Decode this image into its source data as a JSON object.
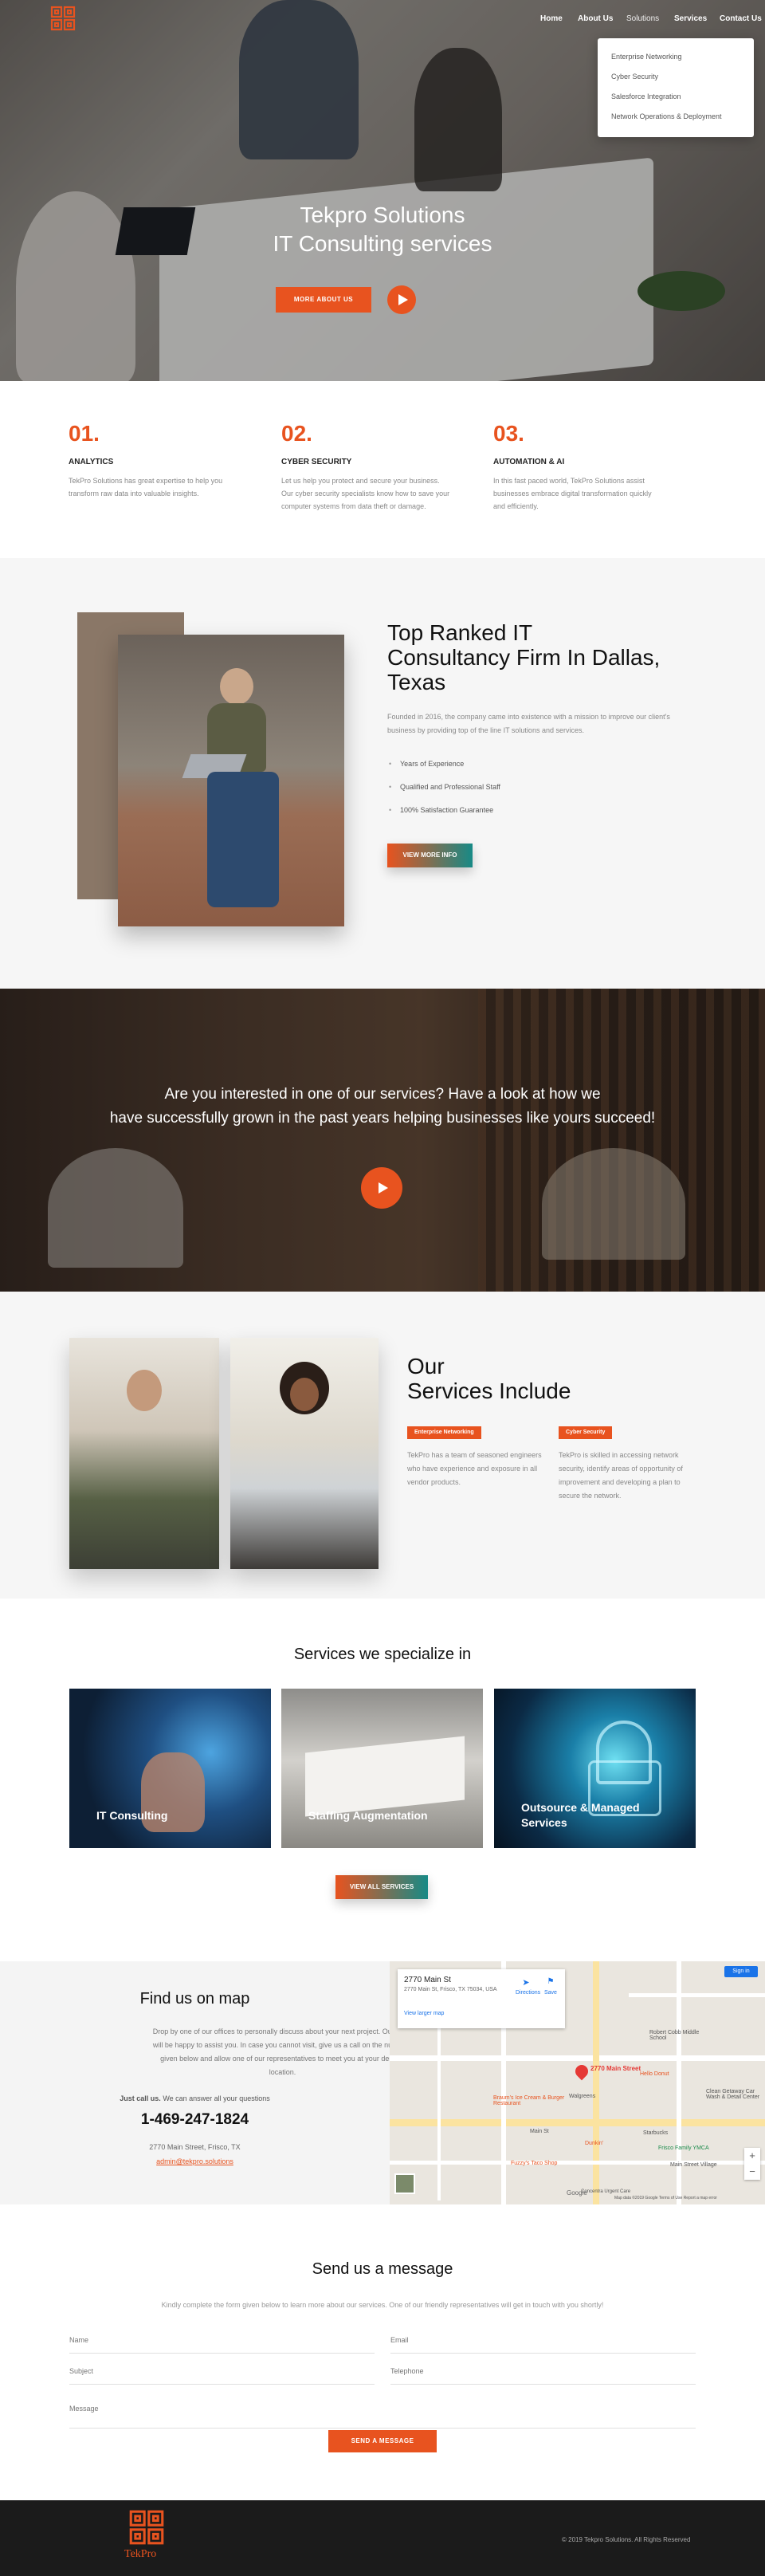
{
  "nav": {
    "logo_text": "TekPro",
    "items": [
      "Home",
      "About Us",
      "Solutions",
      "Services",
      "Contact Us"
    ]
  },
  "dropdown": {
    "items": [
      "Enterprise Networking",
      "Cyber Security",
      "Salesforce Integration",
      "Network Operations & Deployment"
    ]
  },
  "hero": {
    "title_line1": "Tekpro Solutions",
    "title_line2": "IT Consulting services",
    "button": "MORE ABOUT US"
  },
  "features": [
    {
      "num": "01.",
      "title": "ANALYTICS",
      "text": "TekPro Solutions has great expertise to help you transform raw data into valuable insights."
    },
    {
      "num": "02.",
      "title": "CYBER SECURITY",
      "text": "Let us help you protect and secure your business. Our cyber security specialists know how to save your computer systems from data theft or damage."
    },
    {
      "num": "03.",
      "title": "AUTOMATION & AI",
      "text": "In this fast paced world, TekPro Solutions assist businesses embrace digital transformation quickly and efficiently."
    }
  ],
  "about": {
    "title_line1": "Top Ranked IT",
    "title_line2": "Consultancy Firm In Dallas,",
    "title_line3": "Texas",
    "text": "Founded in 2016, the company came into existence with a mission to improve our client's business by providing top of the line IT solutions and services.",
    "checks": [
      "Years of Experience",
      "Qualified and Professional Staff",
      "100% Satisfaction Guarantee"
    ],
    "button": "VIEW MORE INFO"
  },
  "banner": {
    "line1": "Are you interested in one of our services? Have a look at how we",
    "line2": "have successfully grown in the past years helping businesses like yours succeed!"
  },
  "include": {
    "title_line1": "Our",
    "title_line2": "Services Include",
    "items": [
      {
        "tag": "Enterprise Networking",
        "text": "TekPro has a team of seasoned engineers who have experience and exposure in all vendor products."
      },
      {
        "tag": "Cyber Security",
        "text": "TekPro is skilled in accessing network security, identify areas of opportunity of improvement and developing a plan to secure the network."
      }
    ]
  },
  "special": {
    "title": "Services we specialize in",
    "cards": [
      {
        "line1": "IT Consulting",
        "line2": ""
      },
      {
        "line1": "Staffing Augmentation",
        "line2": ""
      },
      {
        "line1": "Outsource & Managed",
        "line2": "Services"
      }
    ],
    "button": "VIEW ALL SERVICES"
  },
  "findus": {
    "title": "Find us on map",
    "text": "Drop by one of our offices to personally discuss about your next project. Our team will be happy to assist you. In case you cannot visit, give us a call on the numbers given below and allow one of our representatives to meet you at your desired location.",
    "call_bold": "Just call us.",
    "call_rest": "We can answer all your questions",
    "phone": "1-469-247-1824",
    "address": "2770 Main Street, Frisco, TX",
    "email": "admin@tekpro.solutions"
  },
  "map": {
    "card_title": "2770 Main St",
    "card_address": "2770 Main St, Frisco, TX 75034, USA",
    "card_link": "View larger map",
    "directions": "Directions",
    "save": "Save",
    "signin": "Sign in",
    "pin_label": "2770 Main Street",
    "places": [
      "Robert Cobb Middle School",
      "Hello Donut",
      "Walgreens",
      "Clean Getaway Car Wash & Detail Center",
      "Braum's Ice Cream & Burger Restaurant",
      "Starbucks",
      "Frisco Family YMCA",
      "Fuzzy's Taco Shop",
      "Main Street Village",
      "Dunkin'",
      "Concentra Urgent Care",
      "Main St"
    ],
    "footer_text": "Map data ©2019 Google   Terms of Use   Report a map error",
    "google": "Google"
  },
  "contact": {
    "title": "Send us a message",
    "subtitle": "Kindly complete the form given below to learn more about our services. One of our friendly representatives will get in touch with you shortly!",
    "fields": {
      "name": "Name",
      "email": "Email",
      "subject": "Subject",
      "telephone": "Telephone",
      "message": "Message"
    },
    "button": "SEND A MESSAGE"
  },
  "footer": {
    "logo_text": "TekPro",
    "copyright": "© 2019 Tekpro Solutions. All Rights Reserved"
  },
  "colors": {
    "accent": "#e8531f",
    "teal": "#178a86",
    "dark": "#1b1b1b"
  }
}
